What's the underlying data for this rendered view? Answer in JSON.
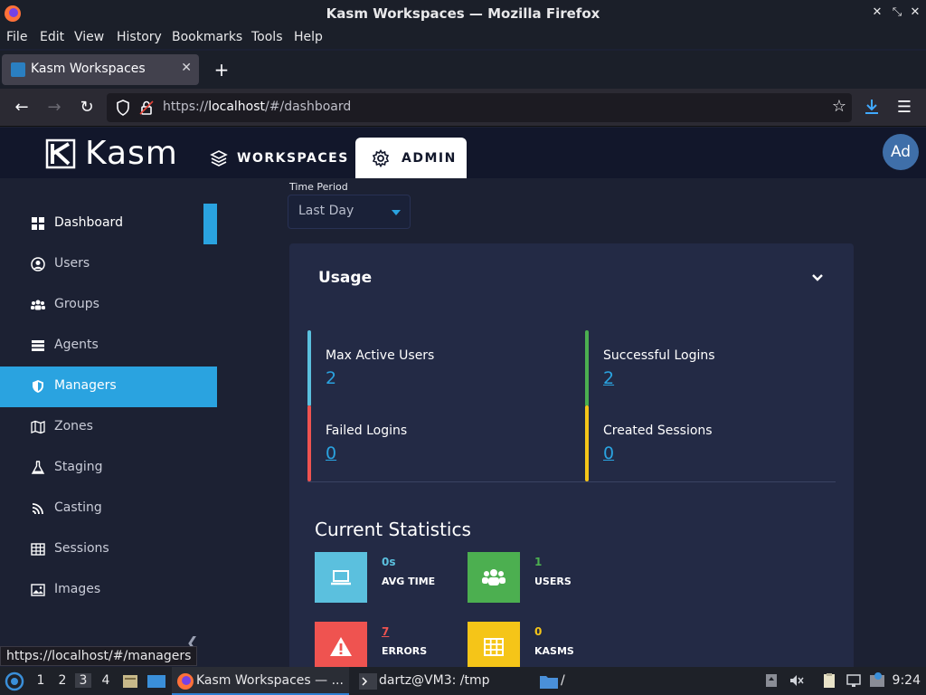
{
  "browser": {
    "window_title": "Kasm Workspaces — Mozilla Firefox",
    "menu": [
      "File",
      "Edit",
      "View",
      "History",
      "Bookmarks",
      "Tools",
      "Help"
    ],
    "tab_title": "Kasm Workspaces",
    "url_prefix": "https://",
    "url_host": "localhost",
    "url_path": "/#/dashboard",
    "status_url": "https://localhost/#/managers"
  },
  "header": {
    "logo_text": "Kasm",
    "nav_workspaces": "WORKSPACES",
    "nav_admin": "ADMIN",
    "avatar_initials": "Ad"
  },
  "sidebar": {
    "items": [
      {
        "label": "Dashboard",
        "icon": "dashboard-icon"
      },
      {
        "label": "Users",
        "icon": "user-circle-icon"
      },
      {
        "label": "Groups",
        "icon": "users-icon"
      },
      {
        "label": "Agents",
        "icon": "server-icon"
      },
      {
        "label": "Managers",
        "icon": "shield-icon"
      },
      {
        "label": "Zones",
        "icon": "map-icon"
      },
      {
        "label": "Staging",
        "icon": "flask-icon"
      },
      {
        "label": "Casting",
        "icon": "cast-icon"
      },
      {
        "label": "Sessions",
        "icon": "table-icon"
      },
      {
        "label": "Images",
        "icon": "image-icon"
      }
    ],
    "accent_color": "#2aa3e0"
  },
  "main": {
    "time_period_label": "Time Period",
    "time_period_value": "Last Day",
    "usage": {
      "title": "Usage",
      "metrics": [
        {
          "label": "Max Active Users",
          "value": "2",
          "color": "#5bc0de"
        },
        {
          "label": "Successful Logins",
          "value": "2",
          "color": "#4caf50"
        },
        {
          "label": "Failed Logins",
          "value": "0",
          "color": "#ef5350"
        },
        {
          "label": "Created Sessions",
          "value": "0",
          "color": "#f5c518"
        }
      ]
    },
    "current_statistics": {
      "title": "Current Statistics",
      "stats": [
        {
          "label": "AVG TIME",
          "value": "0s",
          "color": "#5bc0de",
          "icon": "laptop-icon"
        },
        {
          "label": "USERS",
          "value": "1",
          "color": "#4caf50",
          "icon": "users-icon"
        },
        {
          "label": "ERRORS",
          "value": "7",
          "color": "#ef5350",
          "icon": "warning-icon"
        },
        {
          "label": "KASMS",
          "value": "0",
          "color": "#f5c518",
          "icon": "grid-icon"
        }
      ]
    }
  },
  "taskbar": {
    "workspaces": [
      "1",
      "2",
      "3",
      "4"
    ],
    "tasks": [
      "Kasm Workspaces — ...",
      "dartz@VM3: /tmp",
      "/"
    ],
    "clock": "9:24"
  }
}
